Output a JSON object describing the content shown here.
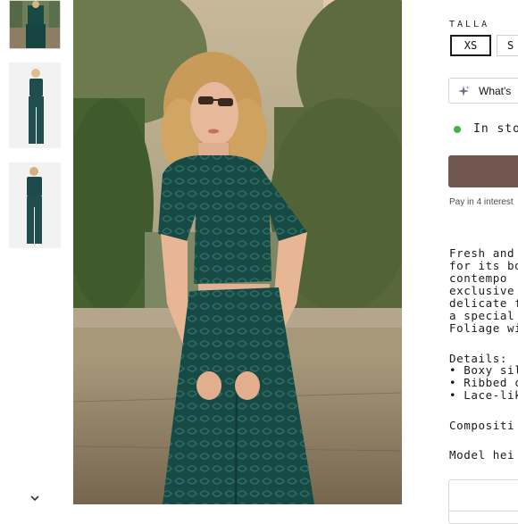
{
  "gallery": {
    "thumbnails": [
      {
        "alt": "model in green lace set, detail"
      },
      {
        "alt": "model in green lace set, front"
      },
      {
        "alt": "model in green lace set, back"
      }
    ],
    "scroll_icon": "chevron-down-icon"
  },
  "product": {
    "size_label": "TALLA",
    "sizes": [
      {
        "label": "XS",
        "selected": true
      },
      {
        "label": "S",
        "selected": false
      }
    ],
    "whats_button_label": "What's",
    "whats_icon": "sparkle-icon",
    "stock_text": "In stoc",
    "stock_color": "#3cb44b",
    "add_button_color": "#725750",
    "pay_text": "Pay in 4 interest",
    "description_lines": [
      "Fresh and",
      "for its box",
      "contempo",
      "exclusive",
      "delicate f",
      "a special",
      "Foliage wi"
    ],
    "details_title": "Details:",
    "details_items": [
      "• Boxy silh",
      "• Ribbed c",
      "• Lace-like"
    ],
    "composition_label": "Compositi",
    "model_height_label": "Model hei"
  }
}
